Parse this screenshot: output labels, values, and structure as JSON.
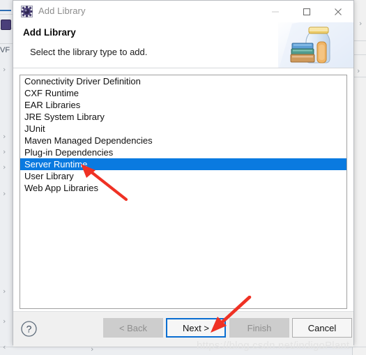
{
  "window": {
    "title": "Add Library",
    "icon": "eclipse-gear-icon",
    "minimize_label": "—",
    "maximize_label": "□",
    "close_label": "✕"
  },
  "header": {
    "title": "Add Library",
    "subtitle": "Select the library type to add.",
    "banner_icon": "library-jar-books-icon"
  },
  "list": {
    "selected_index": 7,
    "items": [
      {
        "label": "Connectivity Driver Definition"
      },
      {
        "label": "CXF Runtime"
      },
      {
        "label": "EAR Libraries"
      },
      {
        "label": "JRE System Library"
      },
      {
        "label": "JUnit"
      },
      {
        "label": "Maven Managed Dependencies"
      },
      {
        "label": "Plug-in Dependencies"
      },
      {
        "label": "Server Runtime"
      },
      {
        "label": "User Library"
      },
      {
        "label": "Web App Libraries"
      }
    ]
  },
  "footer": {
    "help_icon": "help-question-icon",
    "buttons": [
      {
        "label": "< Back",
        "state": "disabled"
      },
      {
        "label": "Next >",
        "state": "focused"
      },
      {
        "label": "Finish",
        "state": "disabled"
      },
      {
        "label": "Cancel",
        "state": "normal"
      }
    ]
  },
  "annotations": {
    "arrow_list_label": "arrow-pointing-to-server-runtime",
    "arrow_next_label": "arrow-pointing-to-next-button",
    "arrow_color": "#ef3124"
  },
  "watermark": {
    "text": "https://blog.csdn.net/indigoPlant"
  },
  "background": {
    "tree_arrow": "›",
    "snippet_top": "VF",
    "snippet_bottom": "‹"
  },
  "colors": {
    "selection": "#0a7ae0",
    "focus_border": "#0a6ed1",
    "accent_red": "#ef3124"
  }
}
